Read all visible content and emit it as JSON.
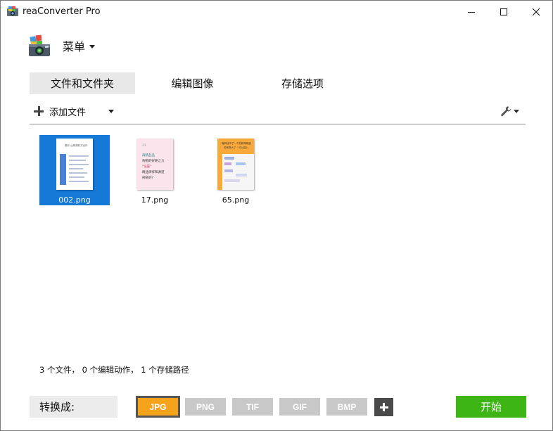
{
  "window": {
    "title": "reaConverter Pro",
    "icons": {
      "app": "reaconverter-app-icon",
      "minimize": "minimize-icon",
      "maximize": "maximize-icon",
      "close": "close-icon"
    }
  },
  "menu": {
    "label": "菜单",
    "logo_icon": "reaconverter-logo-icon",
    "caret_icon": "caret-down-icon"
  },
  "tabs": [
    {
      "label": "文件和文件夹",
      "active": true
    },
    {
      "label": "编辑图像",
      "active": false
    },
    {
      "label": "存储选项",
      "active": false
    }
  ],
  "toolbar": {
    "add_files_label": "添加文件",
    "add_icon": "plus-icon",
    "settings_icon": "wrench-icon"
  },
  "files": [
    {
      "name": "002.png",
      "selected": true
    },
    {
      "name": "17.png",
      "selected": false
    },
    {
      "name": "65.png",
      "selected": false
    }
  ],
  "thumb_text": {
    "t0_title": "是非 山明胡彩式合作",
    "t1_tag": "21",
    "t1_lines": [
      "再精品品",
      "构图的好呢之力",
      "\"设置\"",
      "精品牌作和源道",
      "刑统的?"
    ],
    "t2_title": "高科技中了一个的精采精品",
    "t2_sub": "的家具大了 · 可以进入"
  },
  "status": {
    "text": "3 个文件， 0 个编辑动作， 1 个存储路径"
  },
  "convert": {
    "label": "转换成:",
    "formats": [
      {
        "label": "JPG",
        "selected": true
      },
      {
        "label": "PNG",
        "selected": false
      },
      {
        "label": "TIF",
        "selected": false
      },
      {
        "label": "GIF",
        "selected": false
      },
      {
        "label": "BMP",
        "selected": false
      }
    ],
    "add_format_icon": "plus-icon",
    "start_label": "开始"
  },
  "colors": {
    "selection": "#1479d7",
    "jpg_selected": "#f5a31a",
    "format_inactive": "#c8c8c8",
    "start_button": "#3cb515",
    "tab_active": "#e8e8e8"
  }
}
